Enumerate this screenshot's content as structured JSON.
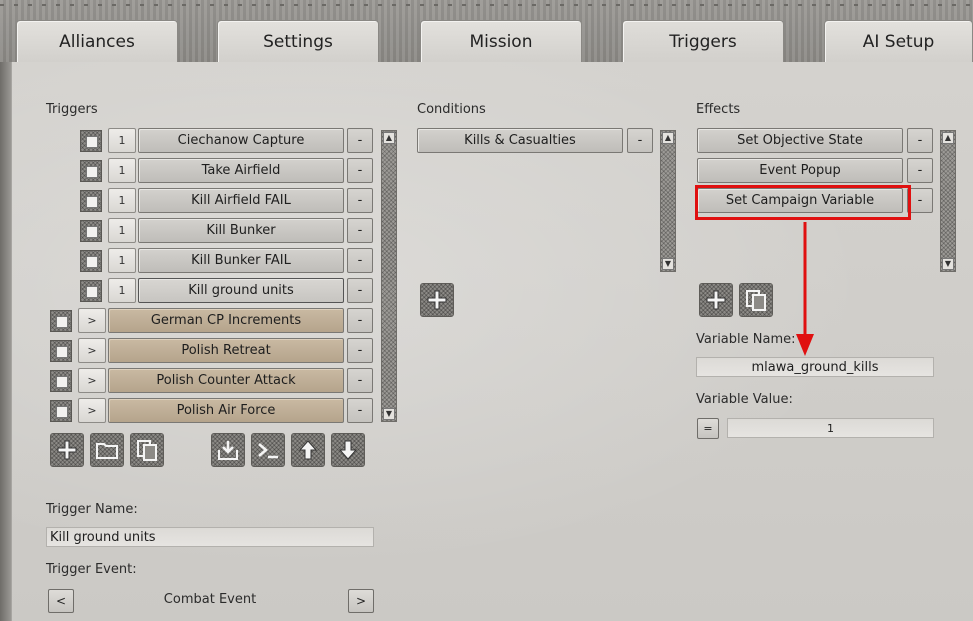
{
  "tabs": [
    {
      "label": "Alliances"
    },
    {
      "label": "Settings"
    },
    {
      "label": "Mission"
    },
    {
      "label": "Triggers"
    },
    {
      "label": "AI Setup"
    }
  ],
  "active_tab": "Triggers",
  "triggers": {
    "heading": "Triggers",
    "items": [
      {
        "index": "1",
        "label": "Ciechanow Capture"
      },
      {
        "index": "1",
        "label": "Take Airfield"
      },
      {
        "index": "1",
        "label": "Kill Airfield FAIL"
      },
      {
        "index": "1",
        "label": "Kill Bunker"
      },
      {
        "index": "1",
        "label": "Kill Bunker FAIL"
      },
      {
        "index": "1",
        "label": "Kill ground units"
      },
      {
        "index": ">",
        "label": "German CP Increments"
      },
      {
        "index": ">",
        "label": "Polish Retreat"
      },
      {
        "index": ">",
        "label": "Polish Counter Attack"
      },
      {
        "index": ">",
        "label": "Polish Air Force"
      }
    ],
    "remove_label": "-",
    "selected": "Kill ground units"
  },
  "conditions": {
    "heading": "Conditions",
    "items": [
      {
        "label": "Kills & Casualties"
      }
    ],
    "remove_label": "-"
  },
  "effects": {
    "heading": "Effects",
    "items": [
      {
        "label": "Set Objective State"
      },
      {
        "label": "Event Popup"
      },
      {
        "label": "Set Campaign Variable"
      }
    ],
    "remove_label": "-",
    "highlighted": "Set Campaign Variable"
  },
  "variable": {
    "name_label": "Variable Name:",
    "name_value": "mlawa_ground_kills",
    "value_label": "Variable Value:",
    "operator": "=",
    "value": "1"
  },
  "trigger_detail": {
    "name_label": "Trigger Name:",
    "name_value": "Kill ground units",
    "event_label": "Trigger Event:",
    "event_value": "Combat Event",
    "prev_label": "<",
    "next_label": ">"
  },
  "colors": {
    "highlight": "#e01010",
    "tan_item": "#c0ae95"
  },
  "icons": [
    "add-icon",
    "folder-icon",
    "copy-icon",
    "import-icon",
    "console-icon",
    "arrow-up-icon",
    "arrow-down-icon"
  ]
}
